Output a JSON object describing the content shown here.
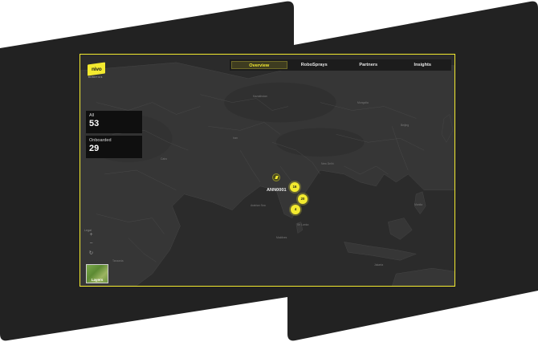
{
  "brand": {
    "logo_text": "nivo",
    "logo_sub": "ROBOTICS",
    "accent": "#f3ea2f"
  },
  "tabs": [
    {
      "label": "Overview",
      "active": true
    },
    {
      "label": "RoboSprays",
      "active": false
    },
    {
      "label": "Partners",
      "active": false
    },
    {
      "label": "Insights",
      "active": false
    }
  ],
  "stats": {
    "all": {
      "label": "All",
      "value": "53"
    },
    "onboarded": {
      "label": "Onboarded",
      "value": "29"
    }
  },
  "map_controls": {
    "zoom_in": "+",
    "zoom_out": "−",
    "reset": "↻",
    "layers_label": "Layers",
    "source_label": "Legal"
  },
  "markers": {
    "ann": {
      "label": "ANN0001"
    },
    "clusters": [
      {
        "count": "16"
      },
      {
        "count": "20"
      },
      {
        "count": "4"
      }
    ]
  },
  "map_labels": {
    "beijing": "Beijing",
    "new_delhi": "New Delhi",
    "arabian_sea": "Arabian Sea",
    "sri_lanka": "Sri Lanka",
    "mongolia": "Mongolia",
    "kazakhstan": "Kazakhstan",
    "iran": "Iran",
    "cairo": "Cairo",
    "jakarta": "Jakarta",
    "manila": "Manila",
    "maldives": "Maldives",
    "tanzania": "Tanzania"
  }
}
